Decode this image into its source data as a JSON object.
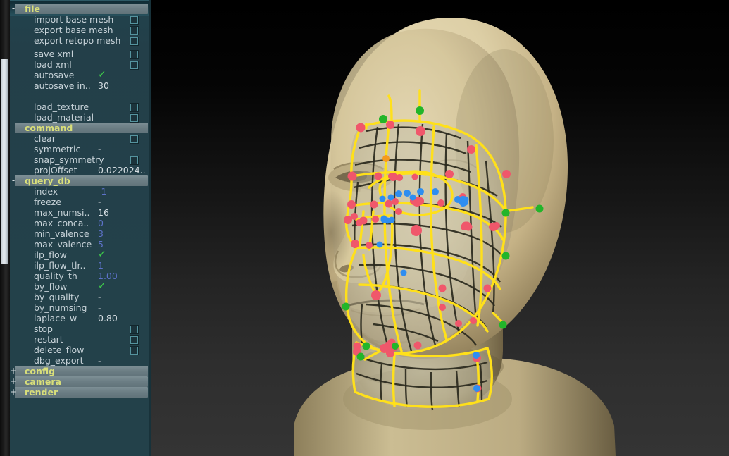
{
  "app": {
    "title": "SketchRetopo2",
    "colors": {
      "panel_bg": "#23414a",
      "section_header_bg": "#6b7d84",
      "section_label": "#d9df7a",
      "label": "#c8d3d9",
      "value_blue": "#5d72c9",
      "value_white": "#d6dee3",
      "checkmark_green": "#3fcf4a",
      "checkbox_border": "#55949f",
      "viewport_top": "#000000",
      "viewport_bottom": "#343434",
      "mesh_line": "#ffe01a",
      "mesh_dark_line": "#2a2a20",
      "vertex_pink": "#f0576b",
      "vertex_green": "#22b52a",
      "vertex_blue": "#2f8ef0",
      "vertex_orange": "#f59a20",
      "skin": "#d6c79b"
    },
    "scrollbar": {
      "name": "vertical-scrollbar",
      "thumb_top_pct": 13,
      "thumb_height_pct": 45
    }
  },
  "panel": {
    "sections": [
      {
        "name": "file",
        "sign": "-",
        "expanded": true,
        "rows": [
          {
            "label": "import base mesh",
            "control": "checkbox"
          },
          {
            "label": "export base mesh",
            "control": "checkbox"
          },
          {
            "label": "export retopo mesh",
            "control": "checkbox"
          },
          {
            "separator": true
          },
          {
            "label": "save xml",
            "control": "checkbox"
          },
          {
            "label": "load xml",
            "control": "checkbox"
          },
          {
            "label": "autosave",
            "control": "check",
            "value": "✓"
          },
          {
            "label": "autosave in..",
            "control": "value",
            "value": "30",
            "value_style": "num-w"
          },
          {
            "spacer": true
          },
          {
            "label": "load_texture",
            "control": "checkbox"
          },
          {
            "label": "load_material",
            "control": "checkbox"
          }
        ]
      },
      {
        "name": "command",
        "sign": "-",
        "expanded": true,
        "rows": [
          {
            "label": "clear",
            "control": "checkbox"
          },
          {
            "label": "symmetric",
            "control": "value",
            "value": "-",
            "value_style": "dash"
          },
          {
            "label": "snap_symmetry",
            "control": "checkbox"
          },
          {
            "label": "projOffset",
            "control": "value",
            "value": "0.022024..",
            "value_style": "num-w"
          }
        ]
      },
      {
        "name": "query_db",
        "sign": "-",
        "expanded": true,
        "rows": [
          {
            "label": "index",
            "control": "value",
            "value": "-1",
            "value_style": "num-b"
          },
          {
            "label": "freeze",
            "control": "value",
            "value": "-",
            "value_style": "dash"
          },
          {
            "label": "max_numsi..",
            "control": "value",
            "value": "16",
            "value_style": "num-w"
          },
          {
            "label": "max_conca..",
            "control": "value",
            "value": "0",
            "value_style": "num-b"
          },
          {
            "label": "min_valence",
            "control": "value",
            "value": "3",
            "value_style": "num-b"
          },
          {
            "label": "max_valence",
            "control": "value",
            "value": "5",
            "value_style": "num-b"
          },
          {
            "label": "ilp_flow",
            "control": "check",
            "value": "✓"
          },
          {
            "label": "ilp_flow_tlr..",
            "control": "value",
            "value": "1",
            "value_style": "num-b"
          },
          {
            "label": "quality_th",
            "control": "value",
            "value": "1.00",
            "value_style": "num-b"
          },
          {
            "label": "by_flow",
            "control": "check",
            "value": "✓"
          },
          {
            "label": "by_quality",
            "control": "value",
            "value": "-",
            "value_style": "dash"
          },
          {
            "label": "by_numsing",
            "control": "value",
            "value": "-",
            "value_style": "dash"
          },
          {
            "label": "laplace_w",
            "control": "value",
            "value": "0.80",
            "value_style": "num-w"
          },
          {
            "label": "stop",
            "control": "checkbox"
          },
          {
            "label": "restart",
            "control": "checkbox"
          },
          {
            "label": "delete_flow",
            "control": "checkbox"
          },
          {
            "label": "dbg_export",
            "control": "value",
            "value": "-",
            "value_style": "dash"
          }
        ]
      },
      {
        "name": "config",
        "sign": "+",
        "expanded": false,
        "rows": []
      },
      {
        "name": "camera",
        "sign": "+",
        "expanded": false,
        "rows": []
      },
      {
        "name": "render",
        "sign": "+",
        "expanded": false,
        "rows": []
      }
    ]
  },
  "viewport": {
    "name": "3d-viewport",
    "subject": "bald human head 3d model, three-quarter view facing left",
    "overlay": "retopology quad patch over forehead, eye, cheek, jaw and neck"
  }
}
